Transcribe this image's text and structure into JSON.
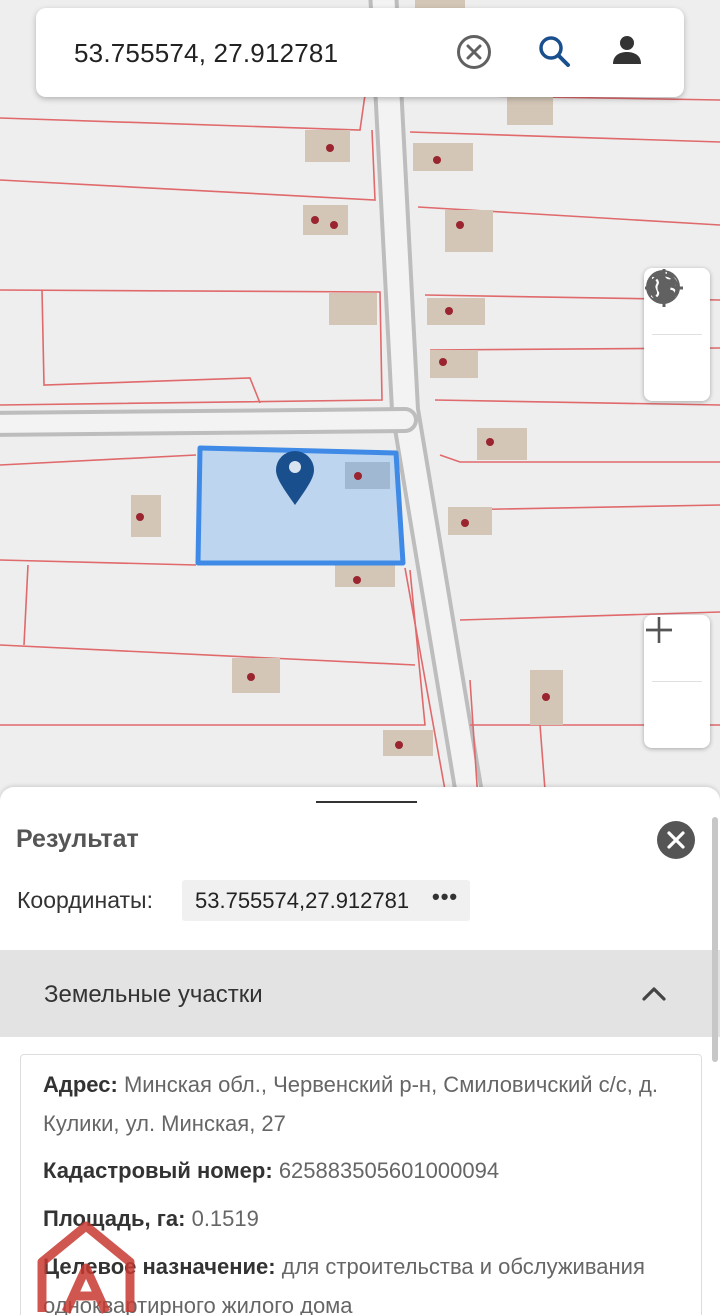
{
  "search": {
    "query": "53.755574, 27.912781"
  },
  "icons": {
    "clear": "clear-circle-icon",
    "search": "search-icon",
    "account": "person-icon",
    "layers": "globe-icon",
    "locate": "my-location-icon",
    "zoom_in": "plus-icon",
    "zoom_out": "minus-icon",
    "marker": "map-marker-icon",
    "close": "close-icon",
    "collapse": "chevron-up-icon",
    "logo": "house-logo-icon"
  },
  "colors": {
    "parcel_highlight_fill": "#b9d3ee",
    "parcel_highlight_stroke": "#3f8ae6",
    "marker": "#1a4f8e",
    "parcel_boundary": "#e0696b",
    "road": "#c9c9c9",
    "building": "#d3c6b6",
    "logo": "#c83a31"
  },
  "result": {
    "title": "Результат",
    "coords_label": "Координаты:",
    "coords_value": "53.755574,27.912781",
    "coords_more": "•••"
  },
  "section": {
    "title": "Земельные участки"
  },
  "parcel": {
    "address_label": "Адрес:",
    "address_value": "Минская обл., Червенский р-н, Смиловичский с/с, д. Кулики, ул. Минская, 27",
    "cadastral_label": "Кадастровый номер:",
    "cadastral_value": "625883505601000094",
    "area_label": "Площадь, га:",
    "area_value": "0.1519",
    "purpose_label": "Целевое назначение:",
    "purpose_value": "для строительства и обслуживания одноквартирного жилого дома"
  }
}
